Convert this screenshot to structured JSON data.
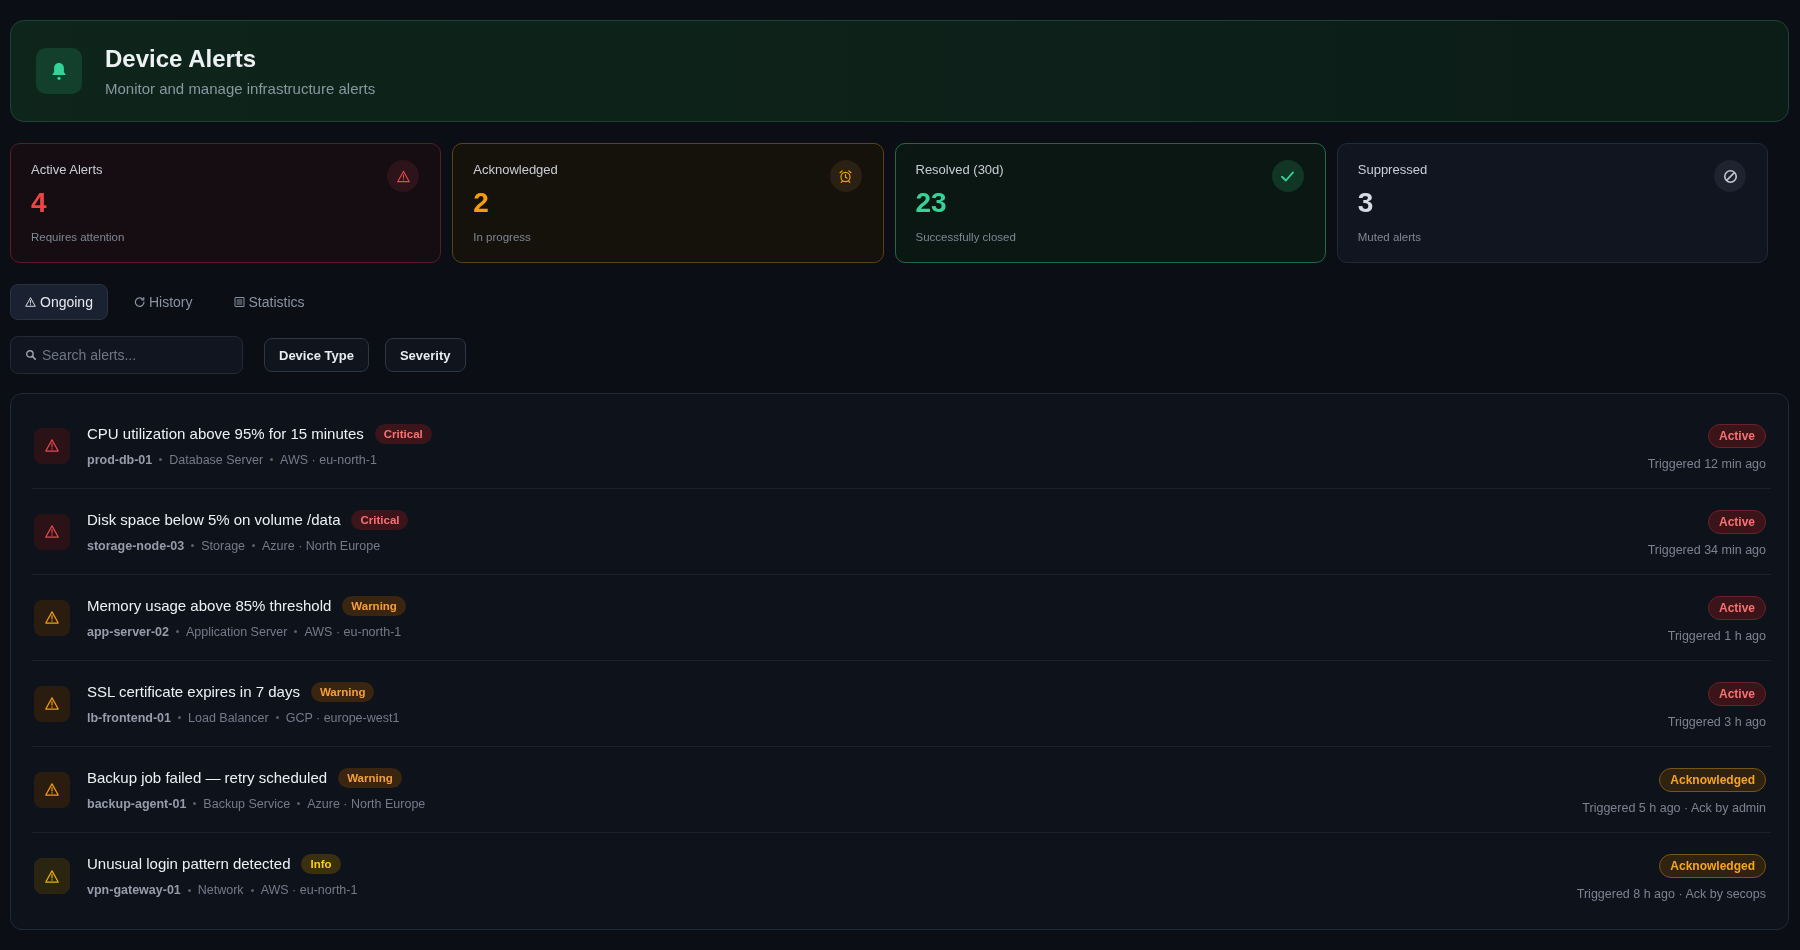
{
  "header": {
    "title": "Device Alerts",
    "subtitle": "Monitor and manage infrastructure alerts"
  },
  "stats": [
    {
      "kind": "active",
      "label": "Active Alerts",
      "value": "4",
      "note": "Requires attention"
    },
    {
      "kind": "acknowledged",
      "label": "Acknowledged",
      "value": "2",
      "note": "In progress"
    },
    {
      "kind": "resolved",
      "label": "Resolved (30d)",
      "value": "23",
      "note": "Successfully closed"
    },
    {
      "kind": "suppressed",
      "label": "Suppressed",
      "value": "3",
      "note": "Muted alerts"
    }
  ],
  "tabs": [
    {
      "label": "Ongoing",
      "selected": true
    },
    {
      "label": "History",
      "selected": false
    },
    {
      "label": "Statistics",
      "selected": false
    }
  ],
  "search": {
    "placeholder": "Search alerts..."
  },
  "filters": [
    "Device Type",
    "Severity"
  ],
  "alerts": [
    {
      "title": "CPU utilization above 95% for 15 minutes",
      "severity": {
        "label": "Critical",
        "kind": "critical"
      },
      "device": "prod-db-01",
      "device_type": "Database Server",
      "location": "AWS · eu-north-1",
      "status": {
        "label": "Active",
        "kind": "active"
      },
      "time": "Triggered 12 min ago"
    },
    {
      "title": "Disk space below 5% on volume /data",
      "severity": {
        "label": "Critical",
        "kind": "critical"
      },
      "device": "storage-node-03",
      "device_type": "Storage",
      "location": "Azure · North Europe",
      "status": {
        "label": "Active",
        "kind": "active"
      },
      "time": "Triggered 34 min ago"
    },
    {
      "title": "Memory usage above 85% threshold",
      "severity": {
        "label": "Warning",
        "kind": "warning"
      },
      "device": "app-server-02",
      "device_type": "Application Server",
      "location": "AWS · eu-north-1",
      "status": {
        "label": "Active",
        "kind": "active"
      },
      "time": "Triggered 1 h ago"
    },
    {
      "title": "SSL certificate expires in 7 days",
      "severity": {
        "label": "Warning",
        "kind": "warning"
      },
      "device": "lb-frontend-01",
      "device_type": "Load Balancer",
      "location": "GCP · europe-west1",
      "status": {
        "label": "Active",
        "kind": "active"
      },
      "time": "Triggered 3 h ago"
    },
    {
      "title": "Backup job failed — retry scheduled",
      "severity": {
        "label": "Warning",
        "kind": "warning"
      },
      "device": "backup-agent-01",
      "device_type": "Backup Service",
      "location": "Azure · North Europe",
      "status": {
        "label": "Acknowledged",
        "kind": "acknowledged"
      },
      "time": "Triggered 5 h ago · Ack by admin"
    },
    {
      "title": "Unusual login pattern detected",
      "severity": {
        "label": "Info",
        "kind": "info"
      },
      "device": "vpn-gateway-01",
      "device_type": "Network",
      "location": "AWS · eu-north-1",
      "status": {
        "label": "Acknowledged",
        "kind": "acknowledged"
      },
      "time": "Triggered 8 h ago · Ack by secops"
    }
  ]
}
